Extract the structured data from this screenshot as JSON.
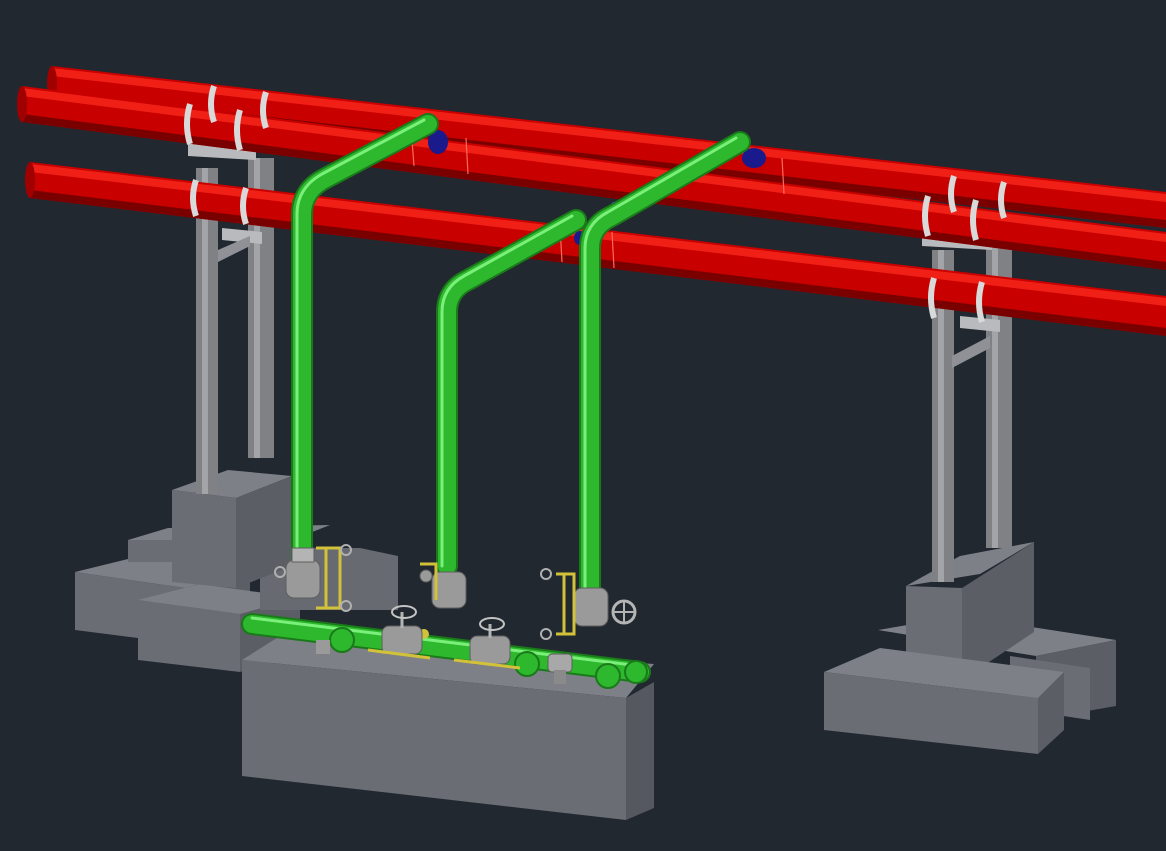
{
  "viewport": {
    "background": "#212830",
    "description_visible_text": ""
  },
  "colors": {
    "fire_main_pipe": "#c80000",
    "fire_main_pipe_highlight": "#ff3a2a",
    "fire_main_pipe_shadow": "#7a0000",
    "riser_pipe": "#2db82d",
    "riser_pipe_highlight": "#6ef06a",
    "riser_pipe_shadow": "#1a7a1a",
    "concrete_top": "#7d8087",
    "concrete_side": "#5b5e64",
    "concrete_front": "#6a6d73",
    "steel_column": "#8a8c90",
    "valve_gray": "#9a9a9a",
    "trim_yellow": "#d2c23a",
    "flange_blue": "#1a1a8c",
    "clamp_white": "#d9d9d9"
  },
  "objects": {
    "main_pipes": [
      "pipe-main-rear",
      "pipe-main-mid",
      "pipe-main-front"
    ],
    "risers": [
      "riser-left",
      "riser-middle",
      "riser-right"
    ],
    "supports": [
      "support-left",
      "support-right"
    ],
    "foundations": [
      "foundation-left",
      "foundation-valve-pad",
      "foundation-right"
    ],
    "valves": [
      "deluge-valve-left",
      "deluge-valve-middle",
      "deluge-valve-right",
      "gate-valve-1",
      "gate-valve-2"
    ]
  }
}
